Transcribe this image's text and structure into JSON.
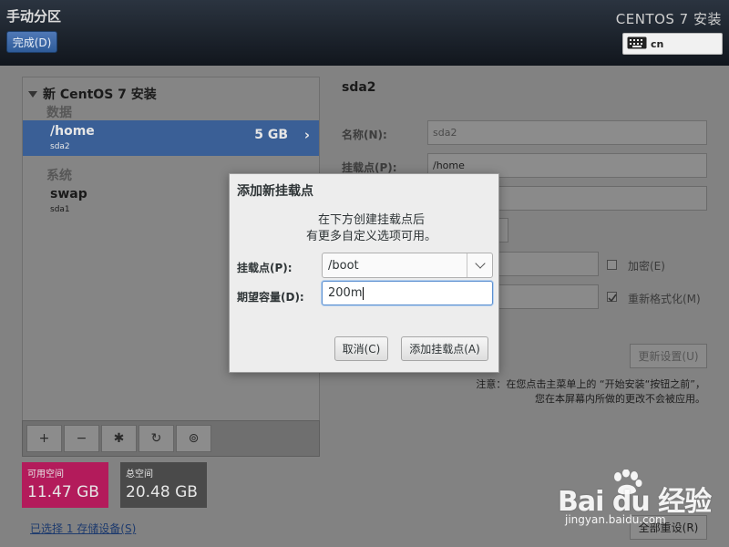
{
  "header": {
    "title": "手动分区",
    "done_label": "完成(D)",
    "product": "CENTOS 7 安装",
    "keyboard_layout": "cn"
  },
  "tree": {
    "root_label": "新 CentOS 7 安装",
    "groups": [
      {
        "label": "数据",
        "items": [
          {
            "name": "/home",
            "device": "sda2",
            "size": "5 GB",
            "selected": true
          }
        ]
      },
      {
        "label": "系统",
        "items": [
          {
            "name": "swap",
            "device": "sda1",
            "size": ""
          }
        ]
      }
    ],
    "toolbar": {
      "add": "+",
      "remove": "−",
      "configure": "✱",
      "refresh": "↻",
      "unlock": "⊚"
    }
  },
  "space": {
    "available_label": "可用空间",
    "available_value": "11.47 GB",
    "available_color": "#b31b5b",
    "total_label": "总空间",
    "total_value": "20.48 GB",
    "total_color": "#4a4a4a"
  },
  "storage_link": "已选择 1 存储设备(S)",
  "detail": {
    "title": "sda2",
    "name_label": "名称(N):",
    "name_value": "sda2",
    "mount_label": "挂载点(P):",
    "mount_value": "/home",
    "encrypt_label": "加密(E)",
    "reformat_label": "重新格式化(M)",
    "update_label": "更新设置(U)",
    "note_line1": "注意：在您点击主菜单上的 “开始安装“按钮之前”，",
    "note_line2": "您在本屏幕内所做的更改不会被应用。",
    "reset_label": "全部重设(R)"
  },
  "dialog": {
    "title": "添加新挂载点",
    "desc_line1": "在下方创建挂载点后",
    "desc_line2": "有更多自定义选项可用。",
    "mount_label": "挂载点(P):",
    "mount_value": "/boot",
    "capacity_label": "期望容量(D):",
    "capacity_value": "200m",
    "cancel_label": "取消(C)",
    "add_label": "添加挂载点(A)"
  },
  "watermark": {
    "main": "Bai du 经验",
    "sub": "jingyan.baidu.com"
  }
}
